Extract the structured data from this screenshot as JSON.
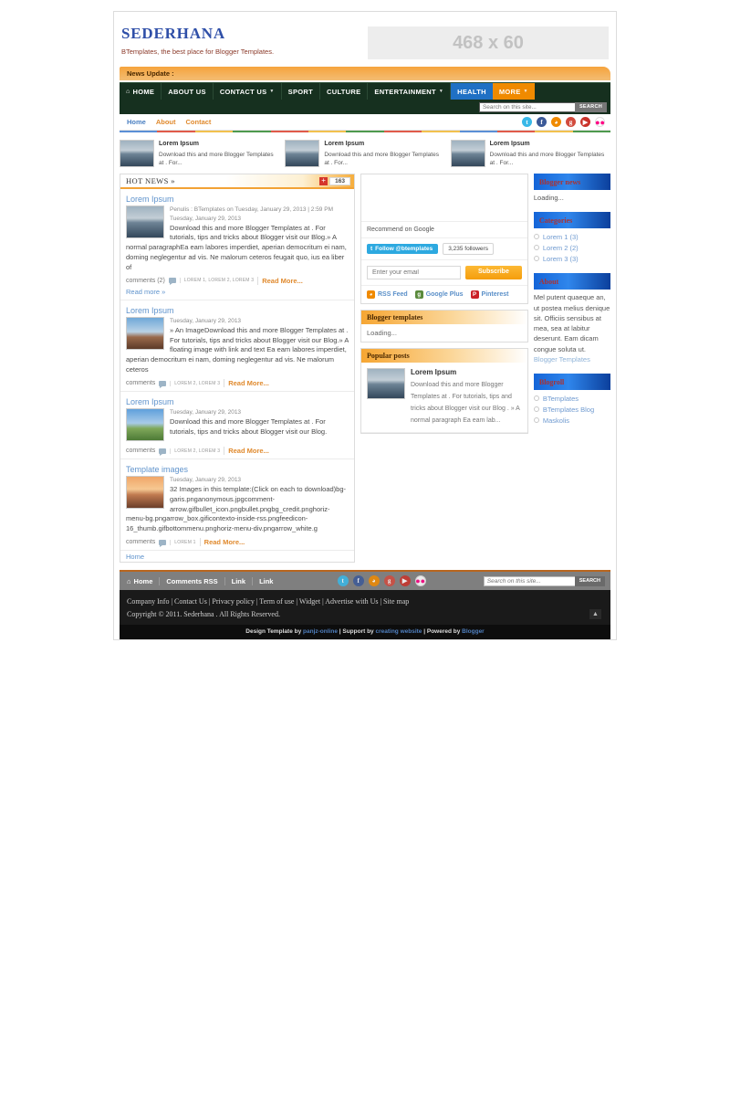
{
  "header": {
    "brand_title": "SEDERHANA",
    "brand_desc": "BTemplates, the best place for Blogger Templates.",
    "banner_label": "468 x 60"
  },
  "news_update": {
    "label": "News Update :"
  },
  "main_nav": {
    "items": [
      {
        "label": "HOME",
        "icon": "home-icon",
        "caret": false,
        "style": "default"
      },
      {
        "label": "ABOUT US",
        "caret": false,
        "style": "default"
      },
      {
        "label": "CONTACT US",
        "caret": true,
        "style": "default"
      },
      {
        "label": "SPORT",
        "caret": false,
        "style": "default"
      },
      {
        "label": "CULTURE",
        "caret": false,
        "style": "default"
      },
      {
        "label": "ENTERTAINMENT",
        "caret": true,
        "style": "default"
      },
      {
        "label": "HEALTH",
        "caret": false,
        "style": "health"
      },
      {
        "label": "MORE",
        "caret": true,
        "style": "more"
      }
    ],
    "caret_glyph": "▼",
    "home_glyph": "⌂"
  },
  "nav_search": {
    "placeholder": "Search on this site...",
    "button": "SEARCH",
    "value": ""
  },
  "sub_nav": {
    "links": [
      {
        "label": "Home",
        "accent": false
      },
      {
        "label": "About",
        "accent": true
      },
      {
        "label": "Contact",
        "accent": true
      }
    ],
    "social": [
      {
        "name": "twitter-icon",
        "glyph": "t",
        "cls": "tw"
      },
      {
        "name": "facebook-icon",
        "glyph": "f",
        "cls": "fb"
      },
      {
        "name": "rss-icon",
        "glyph": "◕",
        "cls": "rs"
      },
      {
        "name": "google-plus-icon",
        "glyph": "g",
        "cls": "gp"
      },
      {
        "name": "youtube-icon",
        "glyph": "▶",
        "cls": "yt"
      },
      {
        "name": "flickr-icon",
        "glyph": "●●",
        "cls": "fl"
      }
    ]
  },
  "featured": [
    {
      "title": "Lorem Ipsum",
      "text": "Download this and more Blogger Templates at . For..."
    },
    {
      "title": "Lorem Ipsum",
      "text": "Download this and more Blogger Templates at . For..."
    },
    {
      "title": "Lorem Ipsum",
      "text": "Download this and more Blogger Templates at . For..."
    }
  ],
  "hot_news": {
    "label": "HOT NEWS »",
    "plus": "+",
    "count": "163"
  },
  "posts": [
    {
      "title": "Lorem Ipsum",
      "meta1": "Penulis : BTemplates on Tuesday, January 29, 2013 | 2:59 PM",
      "meta2": "Tuesday, January 29, 2013",
      "text": "Download this and more Blogger Templates at . For tutorials, tips and tricks about Blogger visit our Blog.» A normal paragraphEa eam labores imperdiet, aperian democritum ei nam, doming neglegentur ad vis. Ne malorum ceteros feugait quo, ius ea liber of",
      "comments": "comments (2)",
      "tags": "LOREM 1, LOREM 2, LOREM 3",
      "read_more": "Read More...",
      "read_more_link": "Read more »",
      "thumb": "a"
    },
    {
      "title": "Lorem Ipsum",
      "meta1": "",
      "meta2": "Tuesday, January 29, 2013",
      "text": "» An ImageDownload this and more Blogger Templates at . For tutorials, tips and tricks about Blogger visit our Blog.» A floating image with link and text Ea eam labores imperdiet, aperian democritum ei nam, doming neglegentur ad vis. Ne malorum ceteros",
      "comments": "comments",
      "tags": "LOREM 2, LOREM 3",
      "read_more": "Read More...",
      "read_more_link": "",
      "thumb": "b"
    },
    {
      "title": "Lorem Ipsum",
      "meta1": "",
      "meta2": "Tuesday, January 29, 2013",
      "text": "Download this and more Blogger Templates at . For tutorials, tips and tricks about Blogger visit our Blog.",
      "comments": "comments",
      "tags": "LOREM 2, LOREM 3",
      "read_more": "Read More...",
      "read_more_link": "",
      "thumb": "c"
    },
    {
      "title": "Template images",
      "meta1": "",
      "meta2": "Tuesday, January 29, 2013",
      "text": "32 Images in this template:(Click on each to download)bg-garis.pnganonymous.jpgcomment-arrow.gifbullet_icon.pngbullet.pngbg_credit.pnghoriz-menu-bg.pngarrow_box.gificontexto-inside-rss.pngfeedicon-16_thumb.gifbottommenu.pnghoriz-menu-div.pngarrow_white.g",
      "comments": "comments",
      "tags": "LOREM 1",
      "read_more": "Read More...",
      "read_more_link": "",
      "thumb": "d"
    }
  ],
  "main_home_link": "Home",
  "middle": {
    "recommend": "Recommend on Google",
    "twitter_follow": "Follow @btemplates",
    "twitter_followers": "3,235 followers",
    "email_placeholder": "Enter your email",
    "email_value": "",
    "subscribe": "Subscribe",
    "feeds": [
      {
        "label": "RSS Feed",
        "name": "rss-icon",
        "glyph": "◕",
        "color": "#f08a00"
      },
      {
        "label": "Google Plus",
        "name": "google-plus-icon",
        "glyph": "g",
        "color": "#5a8a3c"
      },
      {
        "label": "Pinterest",
        "name": "pinterest-icon",
        "glyph": "P",
        "color": "#cb2027"
      }
    ],
    "blogger_templates_title": "Blogger templates",
    "blogger_templates_body": "Loading...",
    "popular_title": "Popular posts",
    "popular_item": {
      "title": "Lorem Ipsum",
      "text": "Download this and more Blogger Templates at . For tutorials, tips and tricks about Blogger visit our Blog . » A normal paragraph Ea eam lab..."
    }
  },
  "right": {
    "blogger_news_title": "Blogger news",
    "blogger_news_body": "Loading...",
    "categories_title": "Categories",
    "categories": [
      "Lorem 1 (3)",
      "Lorem 2 (2)",
      "Lorem 3 (3)"
    ],
    "about_title": "About",
    "about_body": "Mel putent quaeque an, ut postea melius denique sit. Officiis sensibus at mea, sea at labitur deserunt. Eam dicam congue soluta ut.",
    "about_link": "Blogger Templates",
    "blogroll_title": "Blogroll",
    "blogroll": [
      "BTemplates",
      "BTemplates Blog",
      "Maskolis"
    ]
  },
  "footer": {
    "nav": [
      {
        "label": "Home",
        "icon": "home-icon"
      },
      {
        "label": "Comments RSS",
        "icon": ""
      },
      {
        "label": "Link",
        "icon": ""
      },
      {
        "label": "Link",
        "icon": ""
      }
    ],
    "social": [
      {
        "name": "twitter-icon",
        "glyph": "t",
        "cls": "tw"
      },
      {
        "name": "facebook-icon",
        "glyph": "f",
        "cls": "fb"
      },
      {
        "name": "rss-icon",
        "glyph": "◕",
        "cls": "rs"
      },
      {
        "name": "google-plus-icon",
        "glyph": "g",
        "cls": "gp"
      },
      {
        "name": "youtube-icon",
        "glyph": "▶",
        "cls": "yt"
      },
      {
        "name": "flickr-icon",
        "glyph": "●●",
        "cls": "fl"
      }
    ],
    "search_placeholder": "Search on this site...",
    "search_value": "",
    "search_button": "SEARCH",
    "links_line": "Company Info | Contact Us | Privacy policy | Term of use | Widget | Advertise with Us | Site map",
    "copyright": "Copyright © 2011. Sederhana . All Rights Reserved.",
    "to_top": "▲",
    "credit_pre": "Design Template by ",
    "credit_a": "panjz-online",
    "credit_mid": " | Support by ",
    "credit_b": "creating website",
    "credit_mid2": " | Powered by ",
    "credit_c": "Blogger"
  },
  "stripe_colors": [
    "#5b8fd6",
    "#e05a4a",
    "#f2c14e",
    "#4e9a4e",
    "#e05a4a",
    "#f2c14e",
    "#4e9a4e",
    "#e05a4a",
    "#f2c14e",
    "#5b8fd6",
    "#e05a4a",
    "#f2c14e",
    "#4e9a4e"
  ]
}
